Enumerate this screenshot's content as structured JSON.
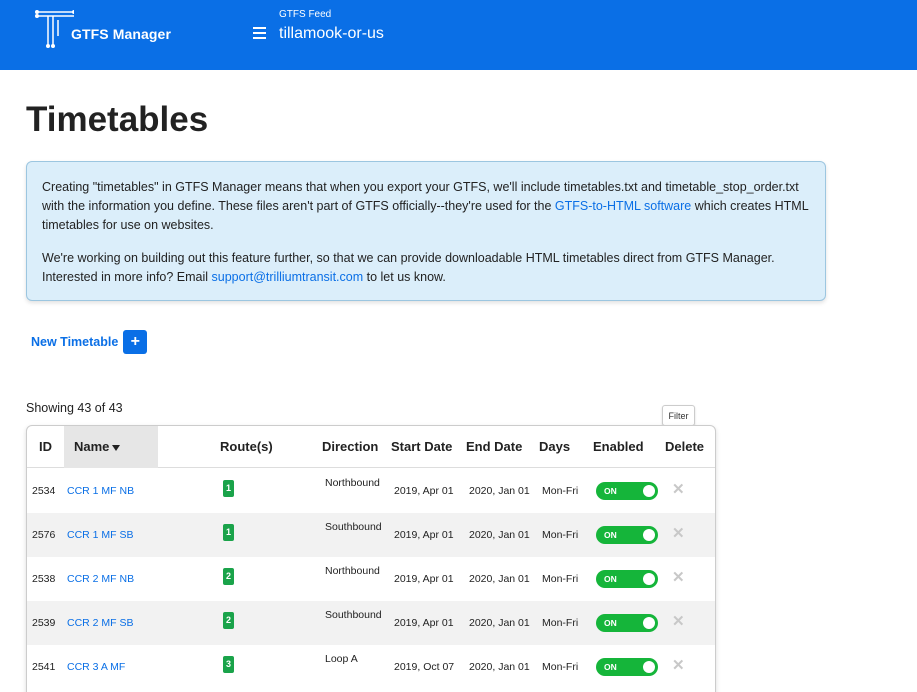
{
  "header": {
    "app_name": "GTFS Manager",
    "feed_label": "GTFS Feed",
    "feed_name": "tillamook-or-us",
    "brand_color": "#0a6fe6",
    "menu_icon": "hamburger-icon"
  },
  "page": {
    "title": "Timetables"
  },
  "info": {
    "p1_before": "Creating \"timetables\" in GTFS Manager means that when you export your GTFS, we'll include timetables.txt and timetable_stop_order.txt with the information you define. These files aren't part of GTFS officially--they're used for the ",
    "p1_link": "GTFS-to-HTML software",
    "p1_after": " which creates HTML timetables for use on websites.",
    "p2_before": "We're working on building out this feature further, so that we can provide downloadable HTML timetables direct from GTFS Manager. Interested in more info? Email ",
    "p2_link": "support@trilliumtransit.com",
    "p2_after": " to let us know."
  },
  "actions": {
    "new_timetable_label": "New Timetable",
    "new_timetable_icon": "+"
  },
  "list": {
    "showing": "Showing 43 of 43",
    "filter_label": "Filter",
    "columns": {
      "id": "ID",
      "name": "Name",
      "routes": "Route(s)",
      "direction": "Direction",
      "start_date": "Start Date",
      "end_date": "End Date",
      "days": "Days",
      "enabled": "Enabled",
      "delete": "Delete"
    },
    "sorted_by": "Name",
    "sort_direction": "descending",
    "toggle_on_color": "#15b53a",
    "route_badge_color": "#1aa34a",
    "rows": [
      {
        "id": "2534",
        "name": "CCR 1 MF NB",
        "route": "1",
        "direction": "Northbound",
        "start": "2019, Apr 01",
        "end": "2020, Jan 01",
        "days": "Mon-Fri",
        "enabled": "ON",
        "delete": "✕"
      },
      {
        "id": "2576",
        "name": "CCR 1 MF SB",
        "route": "1",
        "direction": "Southbound",
        "start": "2019, Apr 01",
        "end": "2020, Jan 01",
        "days": "Mon-Fri",
        "enabled": "ON",
        "delete": "✕"
      },
      {
        "id": "2538",
        "name": "CCR 2 MF NB",
        "route": "2",
        "direction": "Northbound",
        "start": "2019, Apr 01",
        "end": "2020, Jan 01",
        "days": "Mon-Fri",
        "enabled": "ON",
        "delete": "✕"
      },
      {
        "id": "2539",
        "name": "CCR 2 MF SB",
        "route": "2",
        "direction": "Southbound",
        "start": "2019, Apr 01",
        "end": "2020, Jan 01",
        "days": "Mon-Fri",
        "enabled": "ON",
        "delete": "✕"
      },
      {
        "id": "2541",
        "name": "CCR 3 A MF",
        "route": "3",
        "direction": "Loop A",
        "start": "2019, Oct 07",
        "end": "2020, Jan 01",
        "days": "Mon-Fri",
        "enabled": "ON",
        "delete": "✕"
      }
    ]
  }
}
